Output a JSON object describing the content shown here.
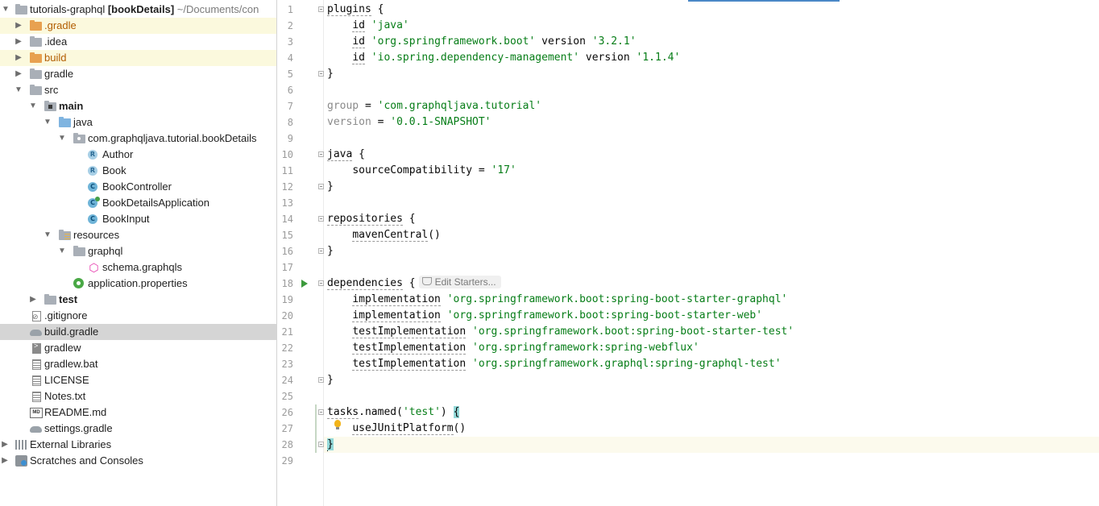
{
  "project": {
    "rows": [
      {
        "label": "tutorials-graphql",
        "suffix_bold": "[bookDetails]",
        "suffix": " ~/Documents/con",
        "icon": "folder-icon",
        "expanded": true
      },
      {
        "label": ".gradle",
        "icon": "folder-orange-icon"
      },
      {
        "label": ".idea",
        "icon": "folder-icon"
      },
      {
        "label": "build",
        "icon": "folder-orange-icon"
      },
      {
        "label": "gradle",
        "icon": "folder-icon"
      },
      {
        "label": "src",
        "icon": "folder-icon"
      },
      {
        "label": "main",
        "icon": "module-folder-icon"
      },
      {
        "label": "java",
        "icon": "source-folder-icon"
      },
      {
        "label": "com.graphqljava.tutorial.bookDetails",
        "icon": "package-icon"
      },
      {
        "label": "Author",
        "icon": "record-icon"
      },
      {
        "label": "Book",
        "icon": "record-icon"
      },
      {
        "label": "BookController",
        "icon": "class-icon"
      },
      {
        "label": "BookDetailsApplication",
        "icon": "spring-app-class-icon"
      },
      {
        "label": "BookInput",
        "icon": "class-icon"
      },
      {
        "label": "resources",
        "icon": "resources-folder-icon"
      },
      {
        "label": "graphql",
        "icon": "folder-icon"
      },
      {
        "label": "schema.graphqls",
        "icon": "graphql-icon"
      },
      {
        "label": "application.properties",
        "icon": "spring-properties-icon"
      },
      {
        "label": "test",
        "icon": "folder-icon"
      },
      {
        "label": ".gitignore",
        "icon": "gitignore-icon"
      },
      {
        "label": "build.gradle",
        "icon": "gradle-icon"
      },
      {
        "label": "gradlew",
        "icon": "script-icon"
      },
      {
        "label": "gradlew.bat",
        "icon": "text-file-icon"
      },
      {
        "label": "LICENSE",
        "icon": "text-file-icon"
      },
      {
        "label": "Notes.txt",
        "icon": "text-file-icon"
      },
      {
        "label": "README.md",
        "icon": "markdown-icon"
      },
      {
        "label": "settings.gradle",
        "icon": "gradle-icon"
      },
      {
        "label": "External Libraries",
        "icon": "libraries-icon"
      },
      {
        "label": "Scratches and Consoles",
        "icon": "scratches-icon"
      }
    ]
  },
  "editor": {
    "line_numbers": [
      "1",
      "2",
      "3",
      "4",
      "5",
      "6",
      "7",
      "8",
      "9",
      "10",
      "11",
      "12",
      "13",
      "14",
      "15",
      "16",
      "17",
      "18",
      "19",
      "20",
      "21",
      "22",
      "23",
      "24",
      "25",
      "26",
      "27",
      "28",
      "29"
    ],
    "hint": "Edit Starters...",
    "lines": {
      "l1_kw": "plugins",
      "l1_rest": " {",
      "l2_kw": "id",
      "l2_str": "'java'",
      "l3_kw": "id",
      "l3_str": "'org.springframework.boot'",
      "l3_mid": " version ",
      "l3_str2": "'3.2.1'",
      "l4_kw": "id",
      "l4_str": "'io.spring.dependency-management'",
      "l4_mid": " version ",
      "l4_str2": "'1.1.4'",
      "l5": "}",
      "l7_kw": "group",
      "l7_mid": " = ",
      "l7_str": "'com.graphqljava.tutorial'",
      "l8_kw": "version",
      "l8_mid": " = ",
      "l8_str": "'0.0.1-SNAPSHOT'",
      "l10_kw": "java",
      "l10_rest": " {",
      "l11_kw": "sourceCompatibility",
      "l11_mid": " = ",
      "l11_str": "'17'",
      "l12": "}",
      "l14_kw": "repositories",
      "l14_rest": " {",
      "l15_kw": "mavenCentral",
      "l15_rest": "()",
      "l16": "}",
      "l18_kw": "dependencies",
      "l18_rest": " {",
      "l19_kw": "implementation",
      "l19_str": "'org.springframework.boot:spring-boot-starter-graphql'",
      "l20_kw": "implementation",
      "l20_str": "'org.springframework.boot:spring-boot-starter-web'",
      "l21_kw": "testImplementation",
      "l21_str": "'org.springframework.boot:spring-boot-starter-test'",
      "l22_kw": "testImplementation",
      "l22_str": "'org.springframework:spring-webflux'",
      "l23_kw": "testImplementation",
      "l23_str": "'org.springframework.graphql:spring-graphql-test'",
      "l24": "}",
      "l26_kw": "tasks",
      "l26_mid": ".named(",
      "l26_str": "'test'",
      "l26_rest": ") ",
      "l26_brace": "{",
      "l27_kw": "useJUnitPlatform",
      "l27_rest": "()",
      "l28": "}"
    }
  },
  "colors": {
    "string": "#067d17",
    "selection": "#d5d5d5",
    "highlight": "#fbf9dd",
    "accent": "#4a88c7"
  }
}
